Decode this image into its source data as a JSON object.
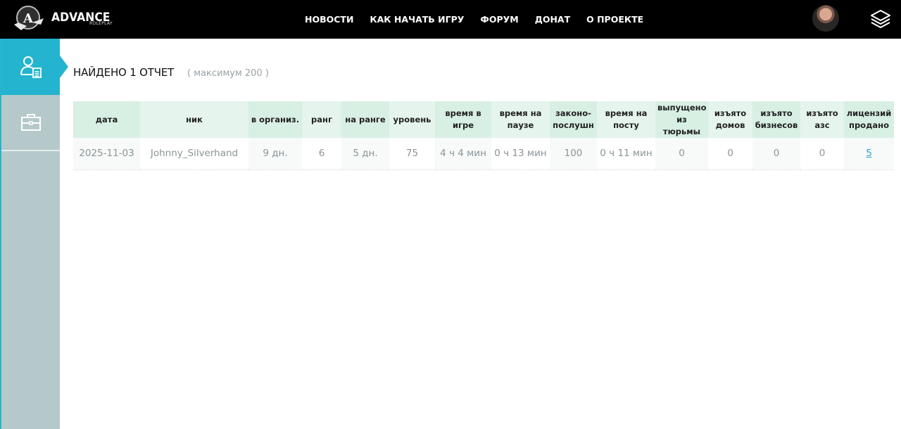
{
  "brand": {
    "name": "ADVANCE",
    "sub": "ROLEPLAY",
    "logo_letter": "A"
  },
  "nav": [
    "НОВОСТИ",
    "КАК НАЧАТЬ ИГРУ",
    "ФОРУМ",
    "ДОНАТ",
    "О ПРОЕКТЕ"
  ],
  "header_icons": {
    "avatar": "user-avatar",
    "menu": "layers-icon"
  },
  "sidebar": {
    "items": [
      {
        "icon": "user-report-icon",
        "active": true
      },
      {
        "icon": "briefcase-icon",
        "active": false
      }
    ]
  },
  "report": {
    "title": "НАЙДЕНО 1 ОТЧЕТ",
    "note": "( максимум 200 )"
  },
  "table": {
    "columns": [
      "дата",
      "ник",
      "в организ.",
      "ранг",
      "на ранге",
      "уровень",
      "время в игре",
      "время на паузе",
      "законо-послушн",
      "время на посту",
      "выпущено из тюрьмы",
      "изъято домов",
      "изъято бизнесов",
      "изъято азс",
      "лицензий продано"
    ],
    "rows": [
      [
        "2025-11-03",
        "Johnny_Silverhand",
        "9 дн.",
        "6",
        "5 дн.",
        "75",
        "4 ч 4 мин",
        "0 ч 13 мин",
        "100",
        "0 ч 11 мин",
        "0",
        "0",
        "0",
        "0",
        "5"
      ]
    ]
  },
  "colors": {
    "accent": "#24b4cf",
    "sidebar": "#b6c9ca",
    "topbar": "#000000",
    "link": "#2f9fd0"
  }
}
